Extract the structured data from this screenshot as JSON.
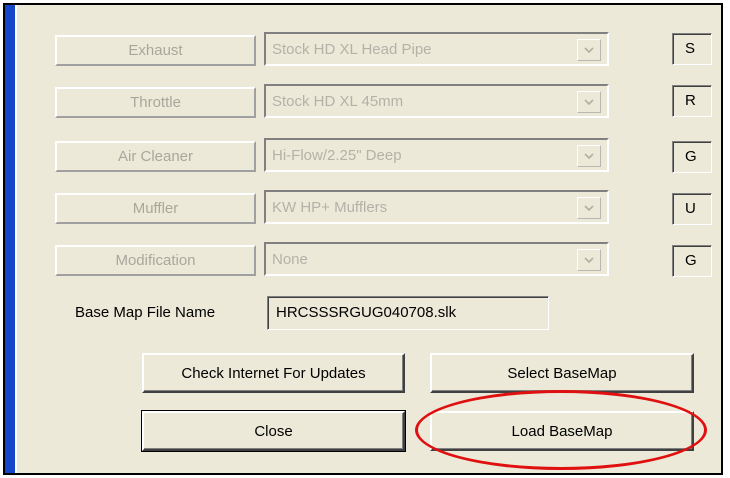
{
  "controls": [
    {
      "label": "Exhaust",
      "value": "Stock HD XL Head Pipe",
      "code": "S"
    },
    {
      "label": "Throttle",
      "value": "Stock HD XL 45mm",
      "code": "R"
    },
    {
      "label": "Air Cleaner",
      "value": "Hi-Flow/2.25\" Deep",
      "code": "G"
    },
    {
      "label": "Muffler",
      "value": "KW HP+ Mufflers",
      "code": "U"
    },
    {
      "label": "Modification",
      "value": "None",
      "code": "G"
    }
  ],
  "base_map": {
    "label": "Base Map File Name",
    "value": "HRCSSSRGUG040708.slk"
  },
  "buttons": {
    "check_updates": "Check Internet For Updates",
    "select_basemap": "Select BaseMap",
    "close": "Close",
    "load_basemap": "Load BaseMap"
  },
  "colors": {
    "highlight": "#e01010",
    "window_edge": "#1747c9",
    "dialog_bg": "#ece9d8"
  }
}
